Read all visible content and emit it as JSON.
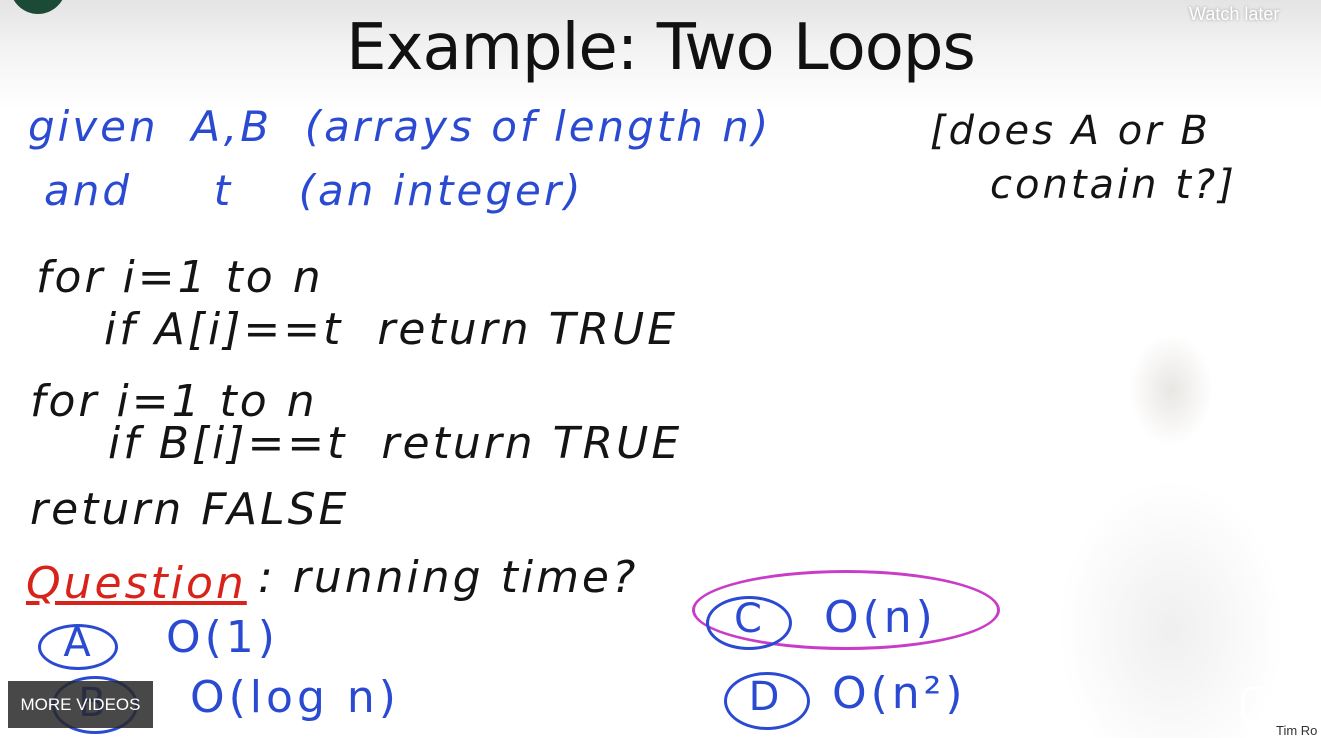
{
  "slide": {
    "title": "Example: Two Loops",
    "given_line1": "given  A,B  (arrays of length n)",
    "given_line2": "and     t    (an integer)",
    "note_line1": "[does A or B",
    "note_line2": "contain t?]",
    "code": [
      "for i=1 to n",
      "if A[i]==t  return TRUE",
      "for i=1 to n",
      "if B[i]==t  return TRUE",
      "return FALSE"
    ],
    "question_label": "Question",
    "question_text": ": running time?",
    "options": [
      {
        "letter": "A",
        "text": "O(1)"
      },
      {
        "letter": "B",
        "text": "O(log n)"
      },
      {
        "letter": "C",
        "text": "O(n)"
      },
      {
        "letter": "D",
        "text": "O(n²)"
      }
    ],
    "highlighted_option": "C"
  },
  "overlay": {
    "watch_later": "Watch later",
    "more_videos": "MORE VIDEOS",
    "channel_name": "Tim Ro",
    "youtube_icon": "youtube-icon"
  },
  "colors": {
    "ink_blue": "#2a4ad2",
    "ink_black": "#141414",
    "ink_red": "#d8231a",
    "highlight_pink": "#c83cc8"
  }
}
